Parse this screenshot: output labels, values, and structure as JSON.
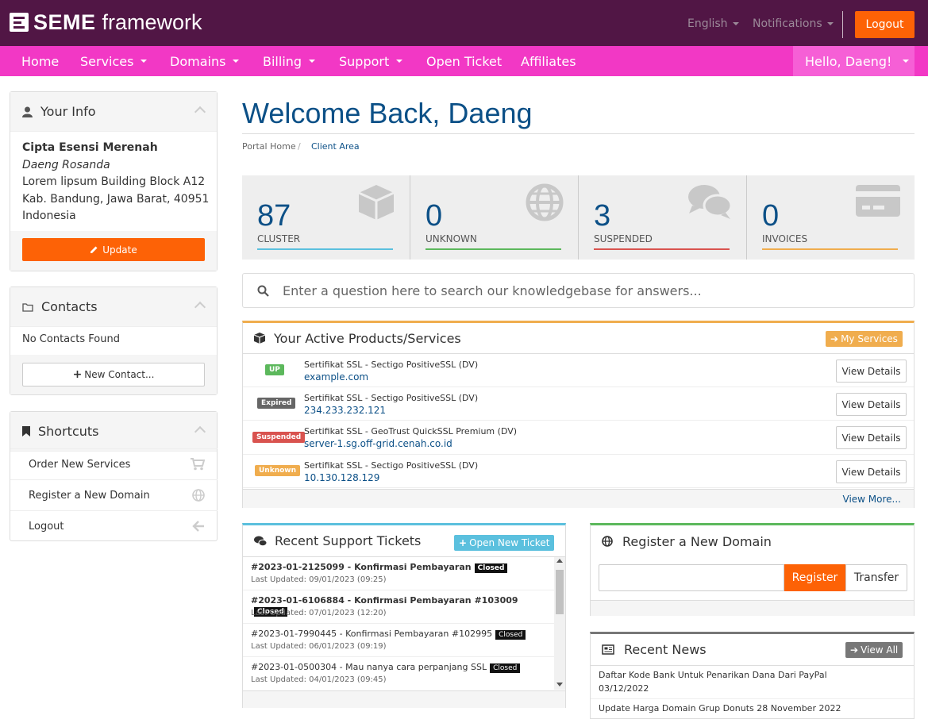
{
  "brand": {
    "strong": "SEME",
    "light": "framework"
  },
  "top": {
    "language": "English",
    "notifications": "Notifications",
    "logout": "Logout"
  },
  "nav": {
    "items": [
      "Home",
      "Services",
      "Domains",
      "Billing",
      "Support",
      "Open Ticket",
      "Affiliates"
    ],
    "hello": "Hello, Daeng!"
  },
  "info": {
    "title": "Your Info",
    "company": "Cipta Esensi Merenah",
    "name": "Daeng Rosanda",
    "address1": "Lorem lipsum Building Block A12",
    "address2": "Kab. Bandung, Jawa Barat, 40951",
    "country": "Indonesia",
    "update": "Update"
  },
  "contacts": {
    "title": "Contacts",
    "empty": "No Contacts Found",
    "new": "New Contact..."
  },
  "shortcuts": {
    "title": "Shortcuts",
    "items": [
      "Order New Services",
      "Register a New Domain",
      "Logout"
    ]
  },
  "main": {
    "title": "Welcome Back, Daeng",
    "breadcrumb": [
      "Portal Home",
      "/",
      "Client Area"
    ],
    "stats": [
      {
        "value": "87",
        "label": "CLUSTER",
        "color": "#5bc0de"
      },
      {
        "value": "0",
        "label": "UNKNOWN",
        "color": "#5cb85c"
      },
      {
        "value": "3",
        "label": "SUSPENDED",
        "color": "#d9534f"
      },
      {
        "value": "0",
        "label": "INVOICES",
        "color": "#f0ad4e"
      }
    ],
    "kb_placeholder": "Enter a question here to search our knowledgebase for answers..."
  },
  "products": {
    "title": "Your Active Products/Services",
    "my_services": "My Services",
    "rows": [
      {
        "status": "UP",
        "status_color": "#5cb85c",
        "name": "Sertifikat SSL - Sectigo PositiveSSL (DV)",
        "domain": "example.com",
        "btn": "View Details"
      },
      {
        "status": "Expired",
        "status_color": "#666666",
        "name": "Sertifikat SSL - Sectigo PositiveSSL (DV)",
        "domain": "234.233.232.121",
        "btn": "View Details"
      },
      {
        "status": "Suspended",
        "status_color": "#d9534f",
        "name": "Sertifikat SSL - GeoTrust QuickSSL Premium (DV)",
        "domain": "server-1.sg.off-grid.cenah.co.id",
        "btn": "View Details"
      },
      {
        "status": "Unknown",
        "status_color": "#f0ad4e",
        "name": "Sertifikat SSL - Sectigo PositiveSSL (DV)",
        "domain": "10.130.128.129",
        "btn": "View Details"
      }
    ],
    "view_more": "View More..."
  },
  "tickets": {
    "title": "Recent Support Tickets",
    "open_new": "Open New Ticket",
    "rows": [
      {
        "subject": "#2023-01-2125099 - Konfirmasi Pembayaran",
        "status": "Closed",
        "updated": "Last Updated: 09/01/2023 (09:25)"
      },
      {
        "subject": "#2023-01-6106884 - Konfirmasi Pembayaran #103009",
        "status": "Closed",
        "updated": "Last Updated: 07/01/2023 (12:20)"
      },
      {
        "subject": "#2023-01-7990445 - Konfirmasi Pembayaran #102995",
        "status": "Closed",
        "updated": "Last Updated: 06/01/2023 (09:19)"
      },
      {
        "subject": "#2023-01-0500304 - Mau nanya cara perpanjang SSL",
        "status": "Closed",
        "updated": "Last Updated: 04/01/2023 (09:45)"
      }
    ]
  },
  "domain": {
    "title": "Register a New Domain",
    "register": "Register",
    "transfer": "Transfer"
  },
  "news": {
    "title": "Recent News",
    "view_all": "View All",
    "items": [
      {
        "title": "Daftar Kode Bank Untuk Penarikan Dana Dari PayPal",
        "date": "03/12/2022"
      },
      {
        "title": "Update Harga Domain Grup Donuts 28 November 2022",
        "date": ""
      }
    ]
  }
}
